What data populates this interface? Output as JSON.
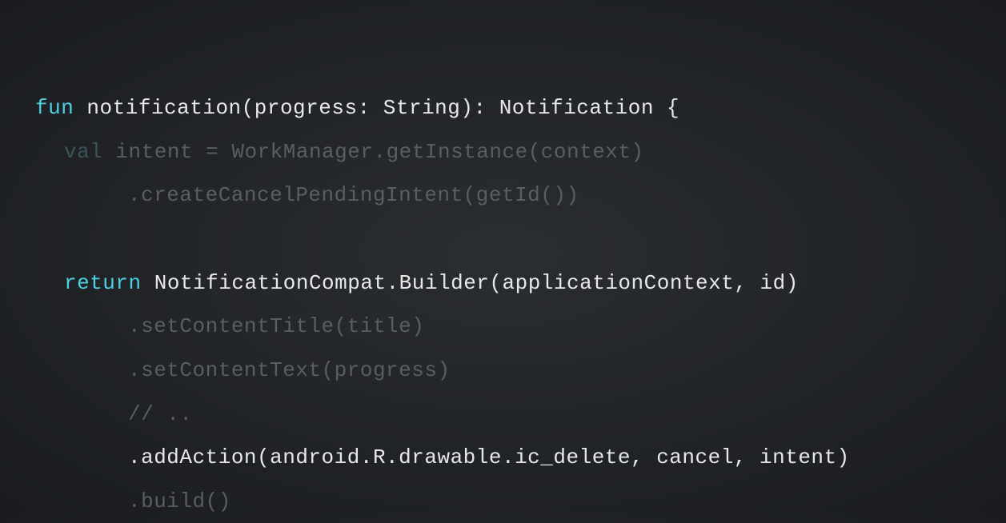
{
  "code": {
    "line1": {
      "keyword": "fun",
      "rest": " notification(progress: String): Notification {"
    },
    "line2": {
      "keyword": "val",
      "rest": " intent = WorkManager.getInstance(context)"
    },
    "line3": {
      "text": ".createCancelPendingIntent(getId())"
    },
    "line4": {
      "keyword": "return",
      "rest": " NotificationCompat.Builder(applicationContext, id)"
    },
    "line5": {
      "text": ".setContentTitle(title)"
    },
    "line6": {
      "text": ".setContentText(progress)"
    },
    "line7": {
      "text": "// .."
    },
    "line8": {
      "text": ".addAction(android.R.drawable.ic_delete, cancel, intent)"
    },
    "line9": {
      "text": ".build()"
    }
  }
}
